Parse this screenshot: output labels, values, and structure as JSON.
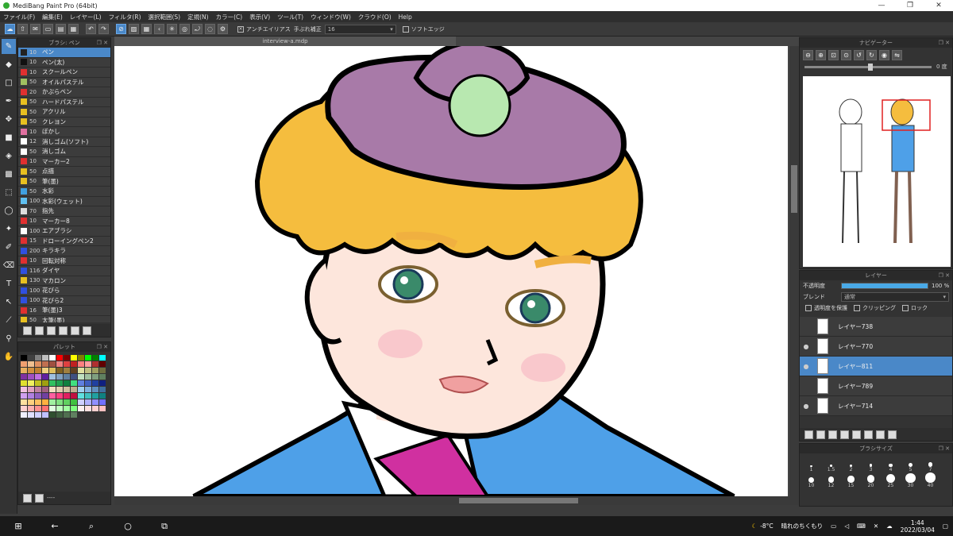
{
  "window": {
    "title": "MediBang Paint Pro (64bit)",
    "min": "—",
    "max": "❐",
    "close": "✕"
  },
  "menu": [
    "ファイル(F)",
    "編集(E)",
    "レイヤー(L)",
    "フィルタ(R)",
    "選択範囲(S)",
    "定規(N)",
    "カラー(C)",
    "表示(V)",
    "ツール(T)",
    "ウィンドウ(W)",
    "クラウド(O)",
    "Help"
  ],
  "toolbar": {
    "antialias": "アンチエイリアス",
    "stabilizer_label": "手ぶれ補正",
    "stabilizer_value": "16",
    "soft_edge": "ソフトエッジ"
  },
  "brush_panel": {
    "title": "ブラシ: ペン",
    "items": [
      {
        "size": "10",
        "name": "ペン",
        "color": "#222222"
      },
      {
        "size": "10",
        "name": "ペン(太)",
        "color": "#111111"
      },
      {
        "size": "10",
        "name": "スクールペン",
        "color": "#e03030"
      },
      {
        "size": "50",
        "name": "オイルパステル",
        "color": "#a0c060"
      },
      {
        "size": "20",
        "name": "かぶらペン",
        "color": "#e03030"
      },
      {
        "size": "50",
        "name": "ハードパステル",
        "color": "#e8c020"
      },
      {
        "size": "50",
        "name": "アクリル",
        "color": "#e8c020"
      },
      {
        "size": "50",
        "name": "クレヨン",
        "color": "#e8c020"
      },
      {
        "size": "10",
        "name": "ぼかし",
        "color": "#e070a0"
      },
      {
        "size": "12",
        "name": "消しゴム(ソフト)",
        "color": "#ffffff"
      },
      {
        "size": "50",
        "name": "消しゴム",
        "color": "#ffffff"
      },
      {
        "size": "10",
        "name": "マーカー2",
        "color": "#e03030"
      },
      {
        "size": "50",
        "name": "点描",
        "color": "#e8c020"
      },
      {
        "size": "50",
        "name": "筆(墨)",
        "color": "#e8c020"
      },
      {
        "size": "50",
        "name": "水彩",
        "color": "#40a0e0"
      },
      {
        "size": "100",
        "name": "水彩(ウェット)",
        "color": "#60c0f0"
      },
      {
        "size": "70",
        "name": "指先",
        "color": "#dddddd"
      },
      {
        "size": "10",
        "name": "マーカー8",
        "color": "#e03030"
      },
      {
        "size": "100",
        "name": "エアブラシ",
        "color": "#ffffff"
      },
      {
        "size": "15",
        "name": "ドローイングペン2",
        "color": "#e03030"
      },
      {
        "size": "200",
        "name": "キラキラ",
        "color": "#3050e0"
      },
      {
        "size": "10",
        "name": "回転対称",
        "color": "#e03030"
      },
      {
        "size": "116",
        "name": "ダイヤ",
        "color": "#3050e0"
      },
      {
        "size": "130",
        "name": "マカロン",
        "color": "#e8c020"
      },
      {
        "size": "100",
        "name": "花びら",
        "color": "#3050e0"
      },
      {
        "size": "100",
        "name": "花びら2",
        "color": "#3050e0"
      },
      {
        "size": "16",
        "name": "筆(墨)3",
        "color": "#e03030"
      },
      {
        "size": "50",
        "name": "太筆(墨)",
        "color": "#e8c020"
      }
    ]
  },
  "palette": {
    "title": "パレット",
    "footer_text": "----",
    "colors": [
      "#000000",
      "#404040",
      "#808080",
      "#c0c0c0",
      "#ffffff",
      "#ff0000",
      "#800000",
      "#ffff00",
      "#808000",
      "#00ff00",
      "#008000",
      "#00ffff",
      "#f0a070",
      "#f0c090",
      "#e09060",
      "#c07050",
      "#a05040",
      "#f08080",
      "#e04040",
      "#c02020",
      "#ff8080",
      "#ffa0a0",
      "#b03030",
      "#600000",
      "#e8b060",
      "#d09040",
      "#c08030",
      "#f0d080",
      "#e0c060",
      "#806020",
      "#a08040",
      "#604020",
      "#e0e0a0",
      "#c0c080",
      "#a0a060",
      "#707040",
      "#8030a0",
      "#a050c0",
      "#c070e0",
      "#6020a0",
      "#a0c0e0",
      "#80a0c0",
      "#6080a0",
      "#405080",
      "#c0e0c0",
      "#a0c0a0",
      "#80a080",
      "#608060",
      "#e0e030",
      "#f0f060",
      "#c0c020",
      "#a0a010",
      "#30c060",
      "#20a050",
      "#108040",
      "#40e080",
      "#6080e0",
      "#4060c0",
      "#2040a0",
      "#102080",
      "#f0c0e0",
      "#e0a0c0",
      "#c080a0",
      "#a06080",
      "#f0e0c0",
      "#e0d0b0",
      "#d0c0a0",
      "#c0b090",
      "#a0d0f0",
      "#80b0e0",
      "#6090c0",
      "#4070a0",
      "#d0a0f0",
      "#b080e0",
      "#9060c0",
      "#7040a0",
      "#ff60a0",
      "#ff4080",
      "#e02060",
      "#c01040",
      "#60e0e0",
      "#40c0c0",
      "#20a0a0",
      "#108080",
      "#ffe0a0",
      "#ffd080",
      "#ffc060",
      "#ffb040",
      "#a0f0a0",
      "#80e080",
      "#60d060",
      "#40c040",
      "#d0d0ff",
      "#b0b0ff",
      "#9090ff",
      "#7070ff",
      "#ffd0d0",
      "#ffb0b0",
      "#ff9090",
      "#ff7070",
      "#e0ffe0",
      "#c0ffc0",
      "#a0ffa0",
      "#80ff80",
      "#fff0f0",
      "#ffe0e0",
      "#ffd0d0",
      "#ffc0c0",
      "#f0f0ff",
      "#e0e0ff",
      "#d0d0ff",
      "#c0c0ff",
      "#305030",
      "#406040",
      "#507050",
      "#608060"
    ]
  },
  "document": {
    "tab": "interview-a.mdp"
  },
  "navigator": {
    "title": "ナビゲーター",
    "angle": "0 度"
  },
  "layers": {
    "title": "レイヤー",
    "opacity_label": "不透明度",
    "opacity_value": "100 %",
    "opacity_fraction": 1.0,
    "blend_label": "ブレンド",
    "blend_value": "通常",
    "protect": "透明度を保護",
    "clipping": "クリッピング",
    "lock": "ロック",
    "items": [
      {
        "name": "レイヤー738",
        "visible": false,
        "selected": false
      },
      {
        "name": "レイヤー770",
        "visible": true,
        "selected": false
      },
      {
        "name": "レイヤー811",
        "visible": true,
        "selected": true
      },
      {
        "name": "レイヤー789",
        "visible": false,
        "selected": false
      },
      {
        "name": "レイヤー714",
        "visible": true,
        "selected": false
      }
    ]
  },
  "brush_size": {
    "title": "ブラシサイズ",
    "sizes": [
      "1",
      "1.5",
      "2",
      "3",
      "4",
      "5",
      "7",
      "10",
      "12",
      "15",
      "20",
      "25",
      "30",
      "40"
    ]
  },
  "taskbar": {
    "temp": "-8°C",
    "weather": "晴れのちくもり",
    "time": "1:44",
    "date": "2022/03/04"
  }
}
